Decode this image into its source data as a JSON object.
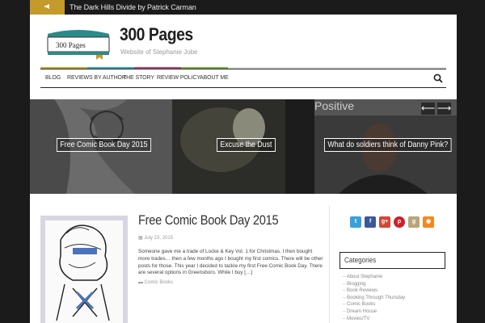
{
  "ticker": {
    "icon": "megaphone-icon",
    "text": "The Dark Hills Divide by Patrick Carman"
  },
  "header": {
    "logo_text": "300 Pages",
    "title": "300 Pages",
    "tagline": "Website of Stephanie Jobe"
  },
  "nav": {
    "items": [
      {
        "label": "Blog"
      },
      {
        "label": "Reviews by Author"
      },
      {
        "label": "The Story"
      },
      {
        "label": "Review Policy"
      },
      {
        "label": "About Me"
      }
    ],
    "search_icon": "search-icon"
  },
  "slider": {
    "slides": [
      {
        "caption": "Free Comic Book Day 2015"
      },
      {
        "caption": "Excuse the Dust"
      },
      {
        "caption": "What do soldiers think of Danny Pink?",
        "overlay_text": "Positive"
      }
    ],
    "prev_arrow": "⟵",
    "next_arrow": "⟶"
  },
  "post": {
    "title": "Free Comic Book Day 2015",
    "date": "July 23, 2015",
    "excerpt": "Someone gave me a trade of Locke & Key Vol. 1 for Christmas. I then bought more trades… then a few months ago I bought my first comics. There will be other posts for those. This year I decided to tackle my first Free Comic Book Day. There are several options in Greensboro. While I buy […]",
    "category": "Comic Books"
  },
  "sidebar": {
    "social": [
      {
        "name": "twitter",
        "glyph": "t",
        "color": "#3aa0d8"
      },
      {
        "name": "facebook",
        "glyph": "f",
        "color": "#3b5998"
      },
      {
        "name": "google-plus",
        "glyph": "g+",
        "color": "#d34836"
      },
      {
        "name": "pinterest",
        "glyph": "p",
        "color": "#c8232c"
      },
      {
        "name": "goodreads",
        "glyph": "g",
        "color": "#b9a57a"
      },
      {
        "name": "rss",
        "glyph": "◉",
        "color": "#f2891f"
      }
    ],
    "widget_title": "Categories",
    "categories": [
      "About Stephanie",
      "Blogging",
      "Book Reviews",
      "Booking Through Thursday",
      "Comic Books",
      "Dream House",
      "Movies/TV"
    ]
  }
}
